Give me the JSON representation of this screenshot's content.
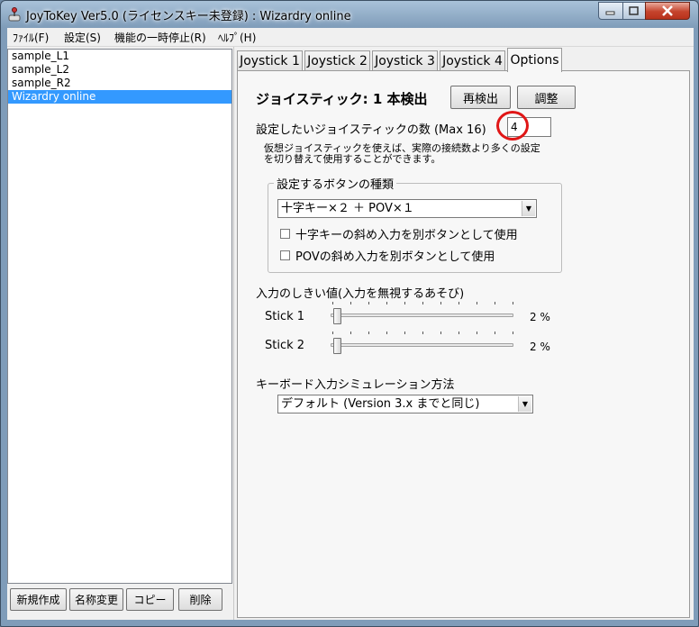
{
  "window": {
    "title": "JoyToKey Ver5.0 (ライセンスキー未登録) : Wizardry online"
  },
  "menu": [
    "ﾌｧｲﾙ(F)",
    "設定(S)",
    "機能の一時停止(R)",
    "ﾍﾙﾌﾟ(H)"
  ],
  "configs": {
    "items": [
      "sample_L1",
      "sample_L2",
      "sample_R2",
      "Wizardry online"
    ],
    "selected": "Wizardry online"
  },
  "config_buttons": {
    "new": "新規作成",
    "rename": "名称変更",
    "copy": "コピー",
    "delete": "削除"
  },
  "tabs": [
    "Joystick 1",
    "Joystick 2",
    "Joystick 3",
    "Joystick 4",
    "Options"
  ],
  "active_tab": "Options",
  "options": {
    "detected": "ジョイスティック: 1 本検出",
    "redetect_button": "再検出",
    "adjust_button": "調整",
    "num_label": "設定したいジョイスティックの数 (Max 16)",
    "num_value": "4",
    "note_line1": "仮想ジョイスティックを使えば、実際の接続数より多くの設定",
    "note_line2": "を切り替えて使用することができます。",
    "button_type_group": "設定するボタンの種類",
    "button_type_value": "十字キー×２ ＋ POV×１",
    "checkbox1": "十字キーの斜め入力を別ボタンとして使用",
    "checkbox2": "POVの斜め入力を別ボタンとして使用",
    "threshold_label": "入力のしきい値(入力を無視するあそび)",
    "stick1_label": "Stick 1",
    "stick1_value": "2 %",
    "stick1_level_percent": 2,
    "stick2_label": "Stick 2",
    "stick2_value": "2 %",
    "stick2_level_percent": 2,
    "sim_label": "キーボード入力シミュレーション方法",
    "sim_value": "デフォルト (Version 3.x までと同じ)"
  },
  "colors": {
    "selection": "#3399ff",
    "annotation": "#e01616",
    "close": "#c5432c"
  }
}
